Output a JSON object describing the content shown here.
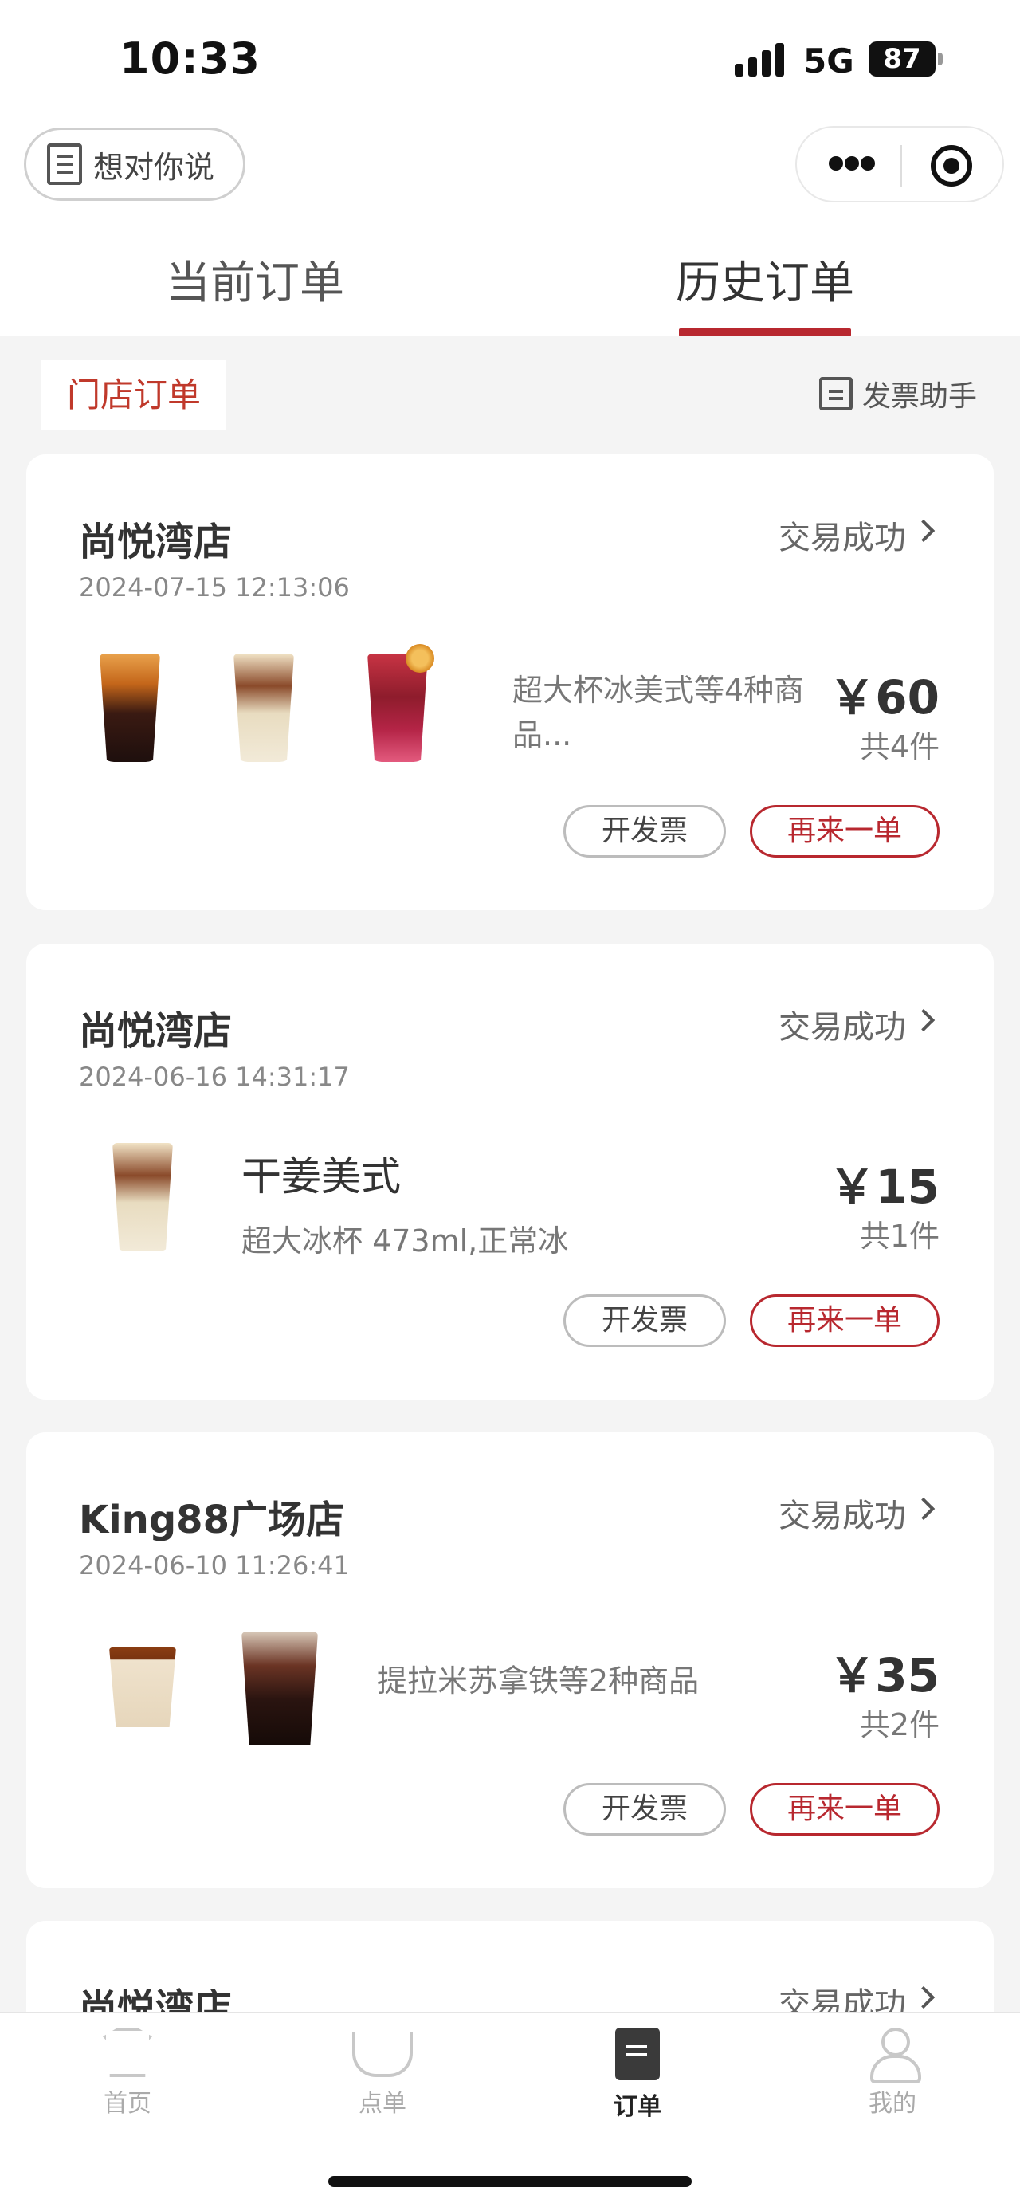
{
  "status_bar": {
    "time": "10:33",
    "network": "5G",
    "battery": "87"
  },
  "header": {
    "feedback_label": "想对你说"
  },
  "tabs": [
    {
      "label": "当前订单"
    },
    {
      "label": "历史订单"
    }
  ],
  "filter": {
    "store_orders": "门店订单",
    "invoice_helper": "发票助手"
  },
  "orders": [
    {
      "store": "尚悦湾店",
      "time": "2024-07-15 12:13:06",
      "status": "交易成功",
      "summary": "超大杯冰美式等4种商品...",
      "price": "￥60",
      "quantity": "共4件",
      "invoice_button": "开发票",
      "reorder_button": "再来一单"
    },
    {
      "store": "尚悦湾店",
      "time": "2024-06-16 14:31:17",
      "status": "交易成功",
      "item_name": "干姜美式",
      "item_spec": "超大冰杯 473ml,正常冰",
      "price": "￥15",
      "quantity": "共1件",
      "invoice_button": "开发票",
      "reorder_button": "再来一单"
    },
    {
      "store": "King88广场店",
      "time": "2024-06-10 11:26:41",
      "status": "交易成功",
      "summary": "提拉米苏拿铁等2种商品",
      "price": "￥35",
      "quantity": "共2件",
      "invoice_button": "开发票",
      "reorder_button": "再来一单"
    },
    {
      "store": "尚悦湾店",
      "status": "交易成功"
    }
  ],
  "bottom_nav": [
    {
      "label": "首页",
      "icon": "home-icon"
    },
    {
      "label": "点单",
      "icon": "coffee-cup-icon"
    },
    {
      "label": "订单",
      "icon": "order-icon"
    },
    {
      "label": "我的",
      "icon": "user-icon"
    }
  ],
  "colors": {
    "accent": "#b8282f",
    "background": "#f4f4f4"
  }
}
